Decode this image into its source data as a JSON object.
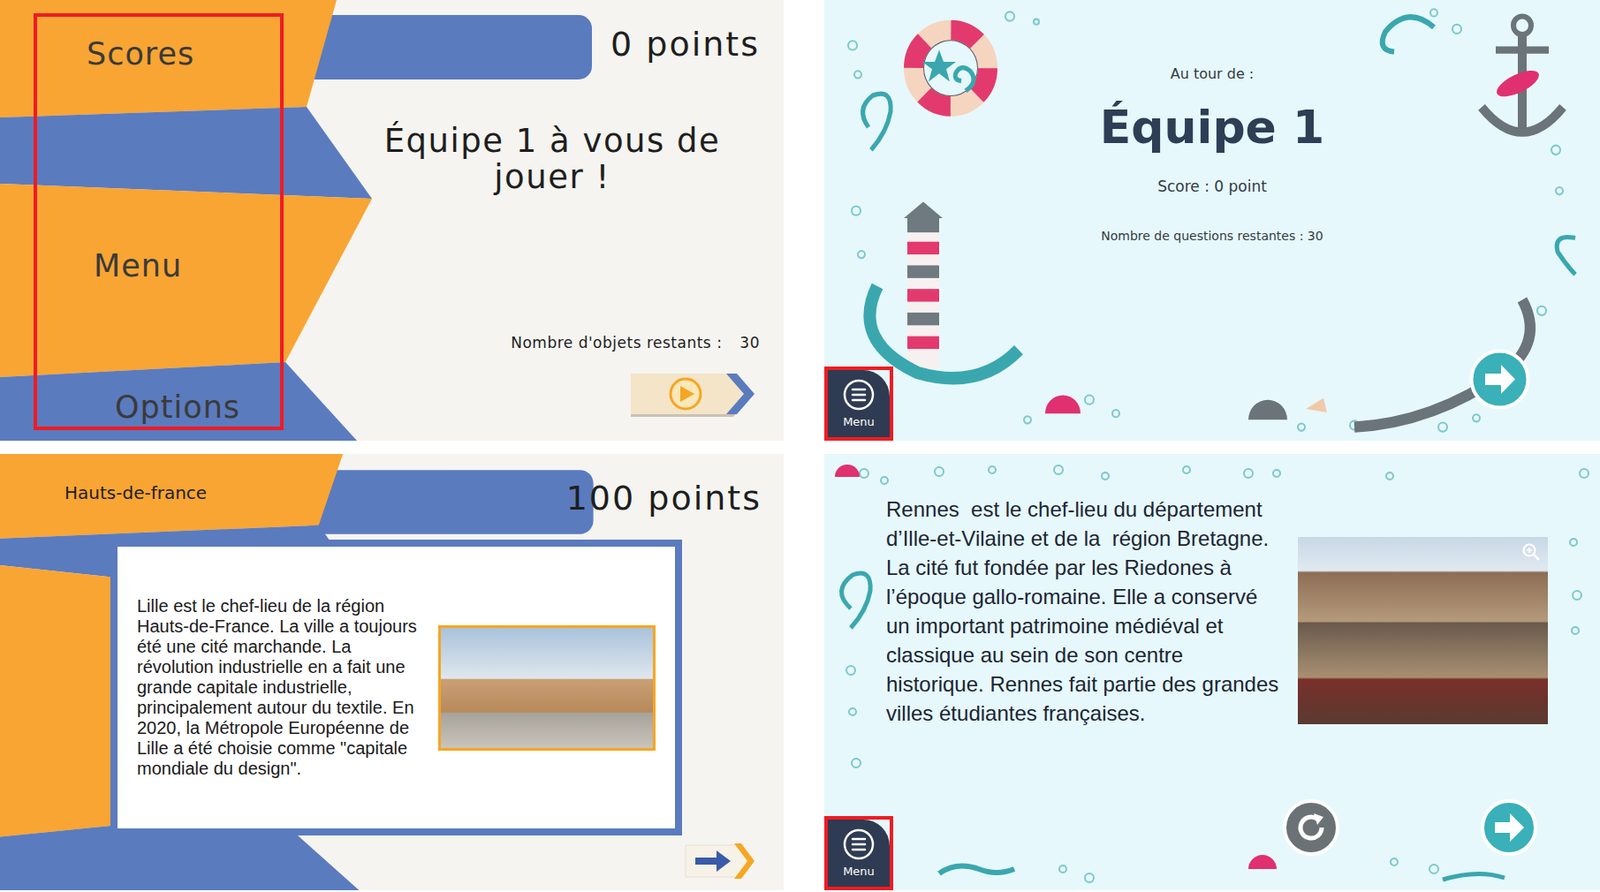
{
  "orange_turn_screen": {
    "menu": {
      "items": [
        "Scores",
        "Menu",
        "Options"
      ],
      "highlighted": true
    },
    "score": "0 points",
    "message": "Équipe 1 à vous de jouer !",
    "remaining_label": "Nombre d'objets restants :",
    "remaining": "30"
  },
  "ocean_turn_screen": {
    "heading": "Au tour de :",
    "team": "Équipe 1",
    "score": "Score : 0 point",
    "remaining": "Nombre de questions restantes : 30",
    "menu_button": {
      "label": "Menu",
      "highlighted": true
    }
  },
  "orange_info_screen": {
    "region": "Hauts-de-france",
    "score": "100 points",
    "text": "Lille est le chef-lieu de la région Hauts-de-France. La ville a toujours été une cité marchande. La révolution industrielle en a fait une grande capitale industrielle, principalement autour du textile. En 2020, la Métropole Européenne de Lille a été choisie comme \"capitale mondiale du design\"."
  },
  "ocean_info_screen": {
    "text": "Rennes  est le chef-lieu du département d’Ille-et-Vilaine et de la  région Bretagne. La cité fut fondée par les Riedones à l’époque gallo-romaine. Elle a conservé un important patrimoine médiéval et classique au sein de son centre historique. Rennes fait partie des grandes villes étudiantes françaises.",
    "menu_button": {
      "label": "Menu",
      "highlighted": true
    }
  }
}
